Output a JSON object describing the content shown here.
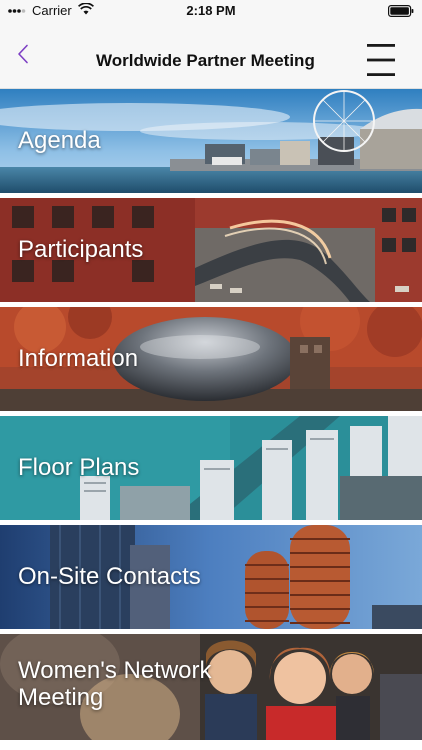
{
  "status_bar": {
    "carrier": "Carrier",
    "time": "2:18 PM",
    "wifi_icon": "wifi-icon",
    "battery_icon": "battery-icon"
  },
  "nav": {
    "title": "Worldwide Partner Meeting",
    "back_icon": "chevron-left-icon",
    "menu_icon": "hamburger-menu-icon",
    "accent_color": "#7d3fc4"
  },
  "tiles": [
    {
      "label": "Agenda"
    },
    {
      "label": "Participants"
    },
    {
      "label": "Information"
    },
    {
      "label": "Floor Plans"
    },
    {
      "label": "On-Site Contacts"
    },
    {
      "label": "Women's Network\nMeeting"
    }
  ]
}
